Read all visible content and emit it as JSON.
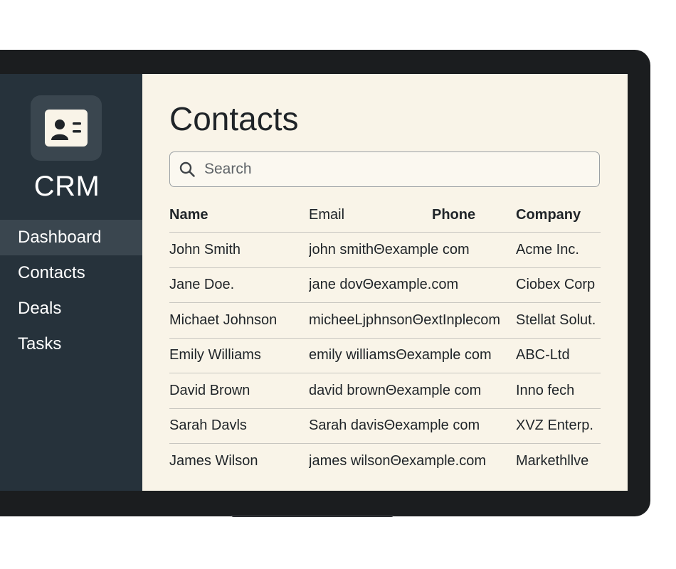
{
  "app": {
    "brand": "CRM",
    "logo_icon": "contact-card-icon"
  },
  "sidebar": {
    "items": [
      {
        "label": "Dashboard",
        "active": true
      },
      {
        "label": "Contacts",
        "active": false
      },
      {
        "label": "Deals",
        "active": false
      },
      {
        "label": "Tasks",
        "active": false
      }
    ]
  },
  "main": {
    "title": "Contacts",
    "search": {
      "placeholder": "Search",
      "value": ""
    },
    "table": {
      "columns": [
        "Name",
        "Email",
        "Phone",
        "Company"
      ],
      "rows": [
        {
          "name": "John Smith",
          "email": "john smithΘexample com",
          "company": "Acme Inc."
        },
        {
          "name": "Jane  Doe.",
          "email": "jane dovΘexample.com",
          "company": "Ciobex Corp"
        },
        {
          "name": "Michaet Johnson",
          "email": "micheeLjphnsonΘextInplecom",
          "company": "Stellat Solut."
        },
        {
          "name": "Emily Williams",
          "email": "emily williamsΘexample com",
          "company": "ABC-Ltd"
        },
        {
          "name": "David Brown",
          "email": "david brownΘexample com",
          "company": "Inno fech"
        },
        {
          "name": "Sarah Davls",
          "email": "Sarah davisΘexample com",
          "company": "XVZ Enterp."
        },
        {
          "name": "James Wilson",
          "email": "james wilsonΘexample.com",
          "company": "Markethllve"
        }
      ]
    }
  },
  "colors": {
    "sidebar_bg": "#26323b",
    "sidebar_active": "#3a464f",
    "content_bg": "#f9f4e8",
    "bezel": "#1b1d1f",
    "text": "#1f2428"
  }
}
